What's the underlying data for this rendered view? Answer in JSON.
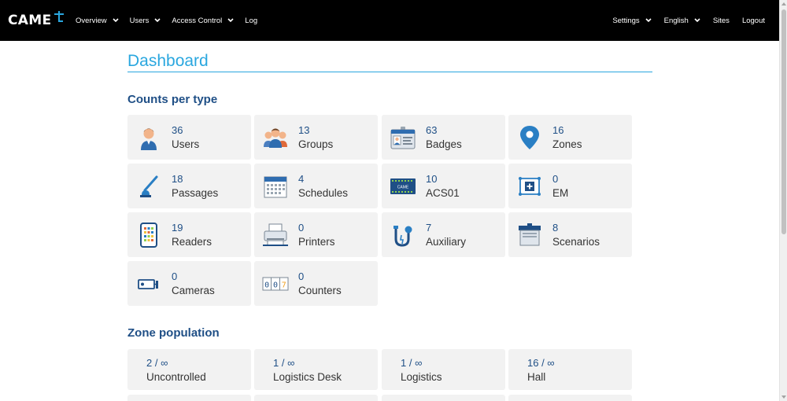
{
  "brand": {
    "name": "CAME",
    "accent": "#2aa7df"
  },
  "nav": {
    "left": [
      {
        "label": "Overview",
        "dropdown": true
      },
      {
        "label": "Users",
        "dropdown": true
      },
      {
        "label": "Access Control",
        "dropdown": true
      },
      {
        "label": "Log",
        "dropdown": false
      }
    ],
    "right": [
      {
        "label": "Settings",
        "dropdown": true
      },
      {
        "label": "English",
        "dropdown": true
      },
      {
        "label": "Sites",
        "dropdown": false
      },
      {
        "label": "Logout",
        "dropdown": false
      }
    ]
  },
  "page": {
    "title": "Dashboard"
  },
  "counts": {
    "title": "Counts per type",
    "items": [
      {
        "count": "36",
        "label": "Users",
        "icon": "user-icon"
      },
      {
        "count": "13",
        "label": "Groups",
        "icon": "groups-icon"
      },
      {
        "count": "63",
        "label": "Badges",
        "icon": "badge-icon"
      },
      {
        "count": "16",
        "label": "Zones",
        "icon": "map-pin-icon"
      },
      {
        "count": "18",
        "label": "Passages",
        "icon": "barrier-icon"
      },
      {
        "count": "4",
        "label": "Schedules",
        "icon": "calendar-icon"
      },
      {
        "count": "10",
        "label": "ACS01",
        "icon": "controller-icon"
      },
      {
        "count": "0",
        "label": "EM",
        "icon": "em-icon"
      },
      {
        "count": "19",
        "label": "Readers",
        "icon": "keypad-icon"
      },
      {
        "count": "0",
        "label": "Printers",
        "icon": "printer-icon"
      },
      {
        "count": "7",
        "label": "Auxiliary",
        "icon": "auxiliary-icon"
      },
      {
        "count": "8",
        "label": "Scenarios",
        "icon": "scenario-icon"
      },
      {
        "count": "0",
        "label": "Cameras",
        "icon": "camera-icon"
      },
      {
        "count": "0",
        "label": "Counters",
        "icon": "counter-icon"
      }
    ],
    "counter_digits": "007",
    "controller_tag": "CAME"
  },
  "zones": {
    "title": "Zone population",
    "items": [
      {
        "value": "2 / ∞",
        "label": "Uncontrolled"
      },
      {
        "value": "1 / ∞",
        "label": "Logistics Desk"
      },
      {
        "value": "1 / ∞",
        "label": "Logistics"
      },
      {
        "value": "16 / ∞",
        "label": "Hall"
      }
    ]
  }
}
